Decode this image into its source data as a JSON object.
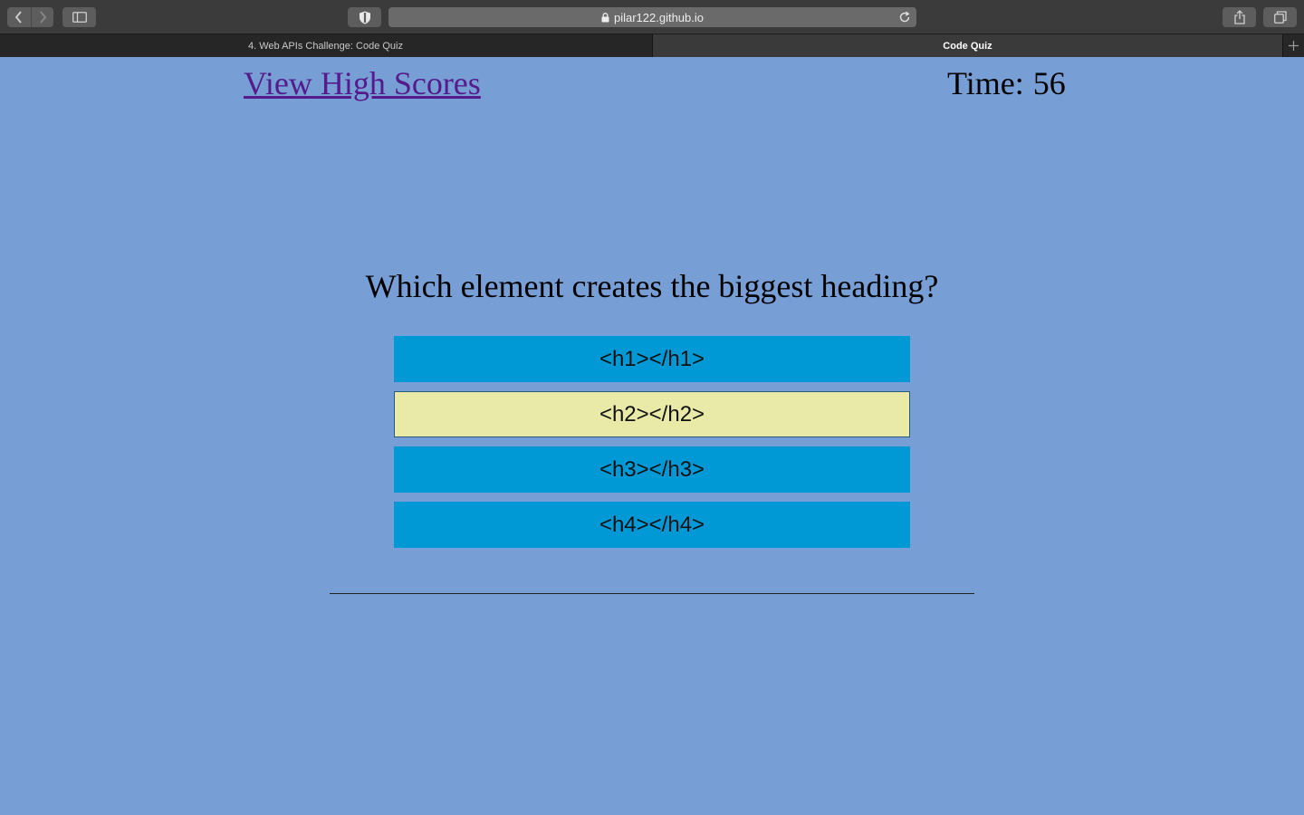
{
  "browser": {
    "url": "pilar122.github.io",
    "tabs": [
      {
        "label": "4. Web APIs Challenge: Code Quiz",
        "active": false
      },
      {
        "label": "Code Quiz",
        "active": true
      }
    ]
  },
  "header": {
    "high_scores_link": "View High Scores",
    "timer_label": "Time:",
    "timer_value": "56"
  },
  "quiz": {
    "question": "Which element creates the biggest heading?",
    "choices": [
      {
        "label": "<h1></h1>",
        "hovered": false
      },
      {
        "label": "<h2></h2>",
        "hovered": true
      },
      {
        "label": "<h3></h3>",
        "hovered": false
      },
      {
        "label": "<h4></h4>",
        "hovered": false
      }
    ]
  },
  "colors": {
    "page_background": "#779fd6",
    "choice_background": "#0099d5",
    "choice_hover_background": "#e9e9a8",
    "link_color": "#551a8b"
  }
}
